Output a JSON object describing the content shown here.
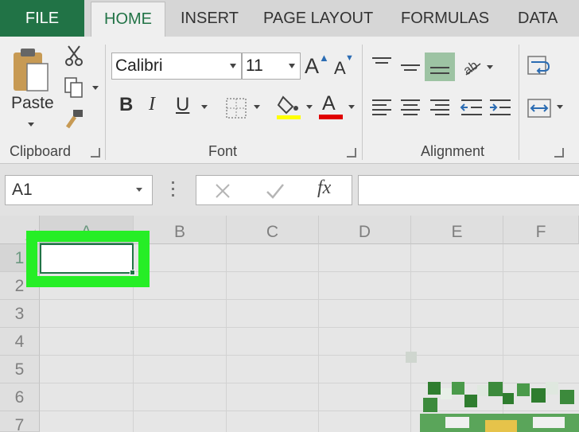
{
  "ribbon": {
    "tabs": [
      "FILE",
      "HOME",
      "INSERT",
      "PAGE LAYOUT",
      "FORMULAS",
      "DATA"
    ],
    "active_tab": "HOME",
    "clipboard": {
      "paste_label": "Paste",
      "group_label": "Clipboard"
    },
    "font": {
      "font_name": "Calibri",
      "font_size": "11",
      "group_label": "Font",
      "bold": "B",
      "italic": "I",
      "underline": "U",
      "grow": "A",
      "shrink": "A",
      "font_color_glyph": "A"
    },
    "alignment": {
      "group_label": "Alignment"
    },
    "colors": {
      "file_tab": "#217346",
      "highlight_bar": "#ffff00",
      "font_color_bar": "#e00000",
      "selection_border": "#26ee26"
    }
  },
  "formula_bar": {
    "cell_ref": "A1",
    "fx": "fx",
    "formula_value": ""
  },
  "grid": {
    "columns": [
      "A",
      "B",
      "C",
      "D",
      "E",
      "F"
    ],
    "rows": [
      "1",
      "2",
      "3",
      "4",
      "5",
      "6",
      "7"
    ],
    "selected_cell": "A1"
  }
}
